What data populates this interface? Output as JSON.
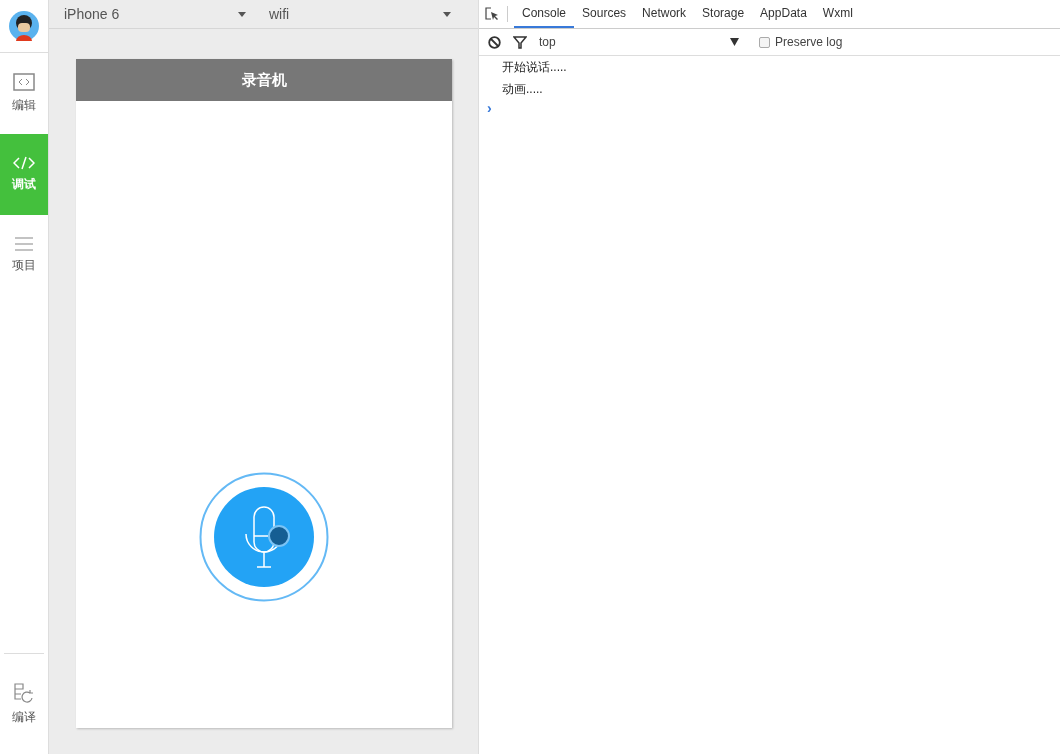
{
  "sidebar": {
    "items": [
      {
        "label": "编辑",
        "kind": "code-box",
        "selected": false
      },
      {
        "label": "调试",
        "kind": "code",
        "selected": true
      },
      {
        "label": "项目",
        "kind": "menu",
        "selected": false
      }
    ],
    "bottom": {
      "label": "编译",
      "kind": "compile"
    }
  },
  "simulator": {
    "device": "iPhone 6",
    "network": "wifi",
    "page_title": "录音机"
  },
  "devtools": {
    "tabs": [
      {
        "label": "Console",
        "selected": true
      },
      {
        "label": "Sources",
        "selected": false
      },
      {
        "label": "Network",
        "selected": false
      },
      {
        "label": "Storage",
        "selected": false
      },
      {
        "label": "AppData",
        "selected": false
      },
      {
        "label": "Wxml",
        "selected": false
      }
    ],
    "context": "top",
    "preserve_log": {
      "label": "Preserve log",
      "checked": false
    },
    "console_lines": [
      "开始说话.....",
      "动画....."
    ],
    "prompt": "›"
  }
}
